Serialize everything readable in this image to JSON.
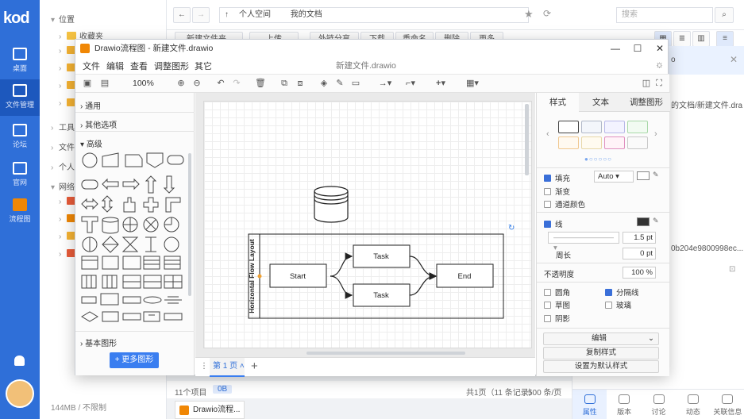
{
  "rail": {
    "logo": "kod",
    "items": [
      {
        "label": "桌面"
      },
      {
        "label": "文件管理"
      },
      {
        "label": "论坛"
      },
      {
        "label": "官网"
      },
      {
        "label": "流程图"
      }
    ]
  },
  "tree": {
    "section_location": "位置",
    "favorites": "收藏夹",
    "tools": "工具",
    "files": "文件",
    "personal": "个人",
    "network": "网络",
    "quota": "144MB / 不限制"
  },
  "topbar": {
    "crumb_home": "个人空间",
    "crumb_docs": "我的文档",
    "search_placeholder": "搜索",
    "new_folder": "新建文件夹",
    "upload": "上传",
    "share": "外链分享",
    "download": "下载",
    "rename": "重命名",
    "delete": "删除",
    "more": "更多"
  },
  "rpanel": {
    "path_fragment": "的文档/新建文件.dra",
    "hash_fragment": "0b204e9800998ec...",
    "letter": "o",
    "tabs": [
      {
        "label": "属性"
      },
      {
        "label": "版本"
      },
      {
        "label": "讨论"
      },
      {
        "label": "动态"
      },
      {
        "label": "关联信息"
      }
    ]
  },
  "status": {
    "count": "11个项目",
    "size": "0B",
    "pages": "共1页（11 条记录）",
    "per_page": "500 条/页",
    "taskbar_item": "Drawio流程..."
  },
  "drawio": {
    "window_title": "Drawio流程图 - 新建文件.drawio",
    "menu": [
      "文件",
      "编辑",
      "查看",
      "调整图形",
      "其它"
    ],
    "file_name": "新建文件.drawio",
    "zoom": "100%",
    "shapes": {
      "general": "通用",
      "misc": "其他选项",
      "advanced": "高级",
      "basic": "基本图形",
      "more_shapes": "+ 更多图形"
    },
    "page_tab": "第 1 页",
    "diagram": {
      "pool_label": "Horizontal Flow Layout",
      "start": "Start",
      "task1": "Task",
      "task2": "Task",
      "end": "End"
    },
    "format": {
      "tabs": [
        "样式",
        "文本",
        "调整图形"
      ],
      "fill": "填充",
      "fill_value": "Auto",
      "gradient": "渐变",
      "transparent_color": "通道颜色",
      "line": "线",
      "line_width": "1.5 pt",
      "perimeter": "周长",
      "perimeter_value": "0 pt",
      "opacity": "不透明度",
      "opacity_value": "100 %",
      "rounded": "圆角",
      "separator": "分隔线",
      "sketch": "草图",
      "glass": "玻璃",
      "shadow": "阴影",
      "edit": "编辑",
      "copy_style": "复制样式",
      "set_default": "设置为默认样式"
    }
  },
  "colors": {
    "rail": "#2f6fd8",
    "accent": "#3a7ef0",
    "drawio_orange": "#f08705"
  }
}
